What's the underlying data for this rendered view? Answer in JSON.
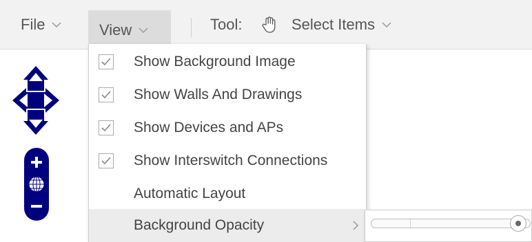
{
  "toolbar": {
    "file_label": "File",
    "view_label": "View",
    "tool_label": "Tool:",
    "tool_icon": "hand-icon",
    "tool_value": "Select Items"
  },
  "view_menu": {
    "items": [
      {
        "label": "Show Background Image",
        "checked": true
      },
      {
        "label": "Show Walls And Drawings",
        "checked": true
      },
      {
        "label": "Show Devices and APs",
        "checked": true
      },
      {
        "label": "Show Interswitch Connections",
        "checked": true
      },
      {
        "label": "Automatic Layout",
        "checked": false
      },
      {
        "label": "Background Opacity",
        "has_submenu": true
      }
    ]
  },
  "opacity_slider": {
    "value_fraction": 0.97
  },
  "colors": {
    "nav_control": "#00007f",
    "toolbar_bg": "#f2f2f2",
    "active_menu_bg": "#dcdcdc"
  }
}
